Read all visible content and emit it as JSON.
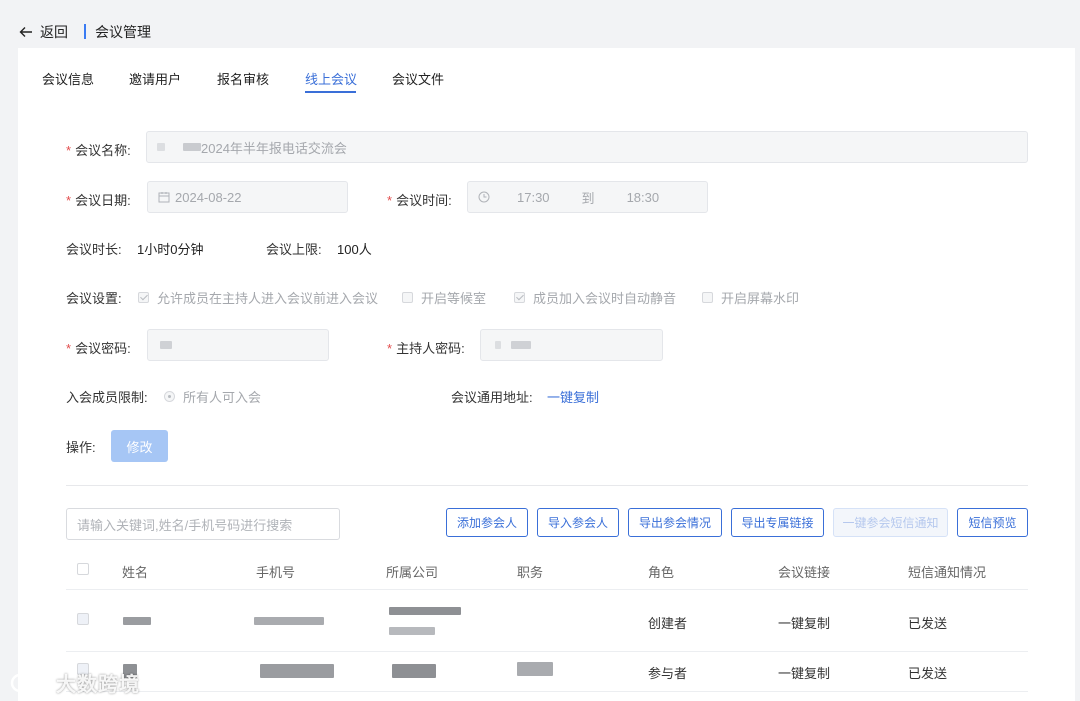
{
  "header": {
    "back_label": "返回",
    "title": "会议管理"
  },
  "tabs": [
    "会议信息",
    "邀请用户",
    "报名审核",
    "线上会议",
    "会议文件"
  ],
  "active_tab": "线上会议",
  "form": {
    "name_label": "会议名称:",
    "name_value": "2024年半年报电话交流会",
    "date_label": "会议日期:",
    "date_value": "2024-08-22",
    "time_label": "会议时间:",
    "time_start": "17:30",
    "time_sep": "到",
    "time_end": "18:30",
    "duration_label": "会议时长:",
    "duration_value": "1小时0分钟",
    "limit_label": "会议上限:",
    "limit_value": "100人",
    "settings_label": "会议设置:",
    "settings": [
      {
        "label": "允许成员在主持人进入会议前进入会议",
        "checked": true
      },
      {
        "label": "开启等候室",
        "checked": false
      },
      {
        "label": "成员加入会议时自动静音",
        "checked": true
      },
      {
        "label": "开启屏幕水印",
        "checked": false
      }
    ],
    "password_label": "会议密码:",
    "host_password_label": "主持人密码:",
    "member_limit_label": "入会成员限制:",
    "member_limit_value": "所有人可入会",
    "address_label": "会议通用地址:",
    "address_link": "一键复制",
    "ops_label": "操作:",
    "modify_button": "修改"
  },
  "toolbar": {
    "search_placeholder": "请输入关键词,姓名/手机号码进行搜索",
    "buttons": [
      "添加参会人",
      "导入参会人",
      "导出参会情况",
      "导出专属链接",
      "一键参会短信通知",
      "短信预览"
    ]
  },
  "table": {
    "columns": [
      "姓名",
      "手机号",
      "所属公司",
      "职务",
      "角色",
      "会议链接",
      "短信通知情况"
    ],
    "rows": [
      {
        "role": "创建者",
        "link": "一键复制",
        "sms": "已发送"
      },
      {
        "role": "参与者",
        "link": "一键复制",
        "sms": "已发送"
      }
    ]
  },
  "watermark": "大数跨境",
  "colors": {
    "accent": "#3a6fd8",
    "required": "#e24c4c",
    "disabled_btn": "#a6c6f5"
  }
}
